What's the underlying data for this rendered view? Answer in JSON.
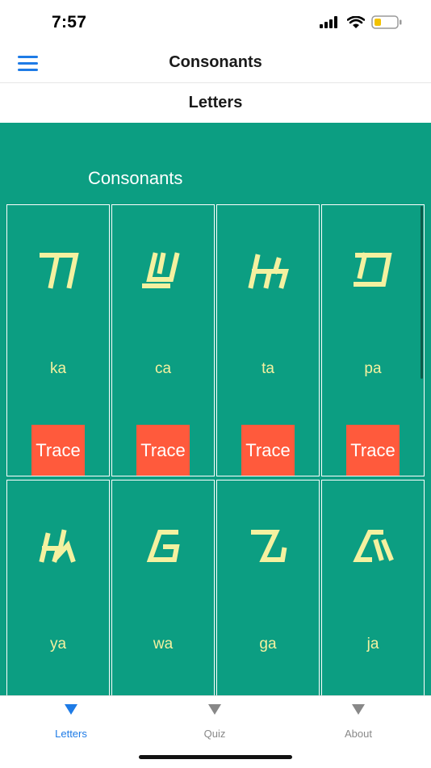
{
  "status_bar": {
    "time": "7:57",
    "icons": [
      "signal-icon",
      "wifi-icon",
      "battery-low-icon"
    ]
  },
  "navbar": {
    "title": "Consonants",
    "menu_icon": "hamburger-menu-icon",
    "accent_color": "#1e7be6"
  },
  "subheader": {
    "title": "Letters"
  },
  "content": {
    "section_title": "Consonants",
    "background_color": "#0c9e82",
    "letters": [
      {
        "glyph_icon": "ka-glyph-icon",
        "romanized": "ka",
        "trace_label": "Trace"
      },
      {
        "glyph_icon": "ca-glyph-icon",
        "romanized": "ca",
        "trace_label": "Trace"
      },
      {
        "glyph_icon": "ta-glyph-icon",
        "romanized": "ta",
        "trace_label": "Trace"
      },
      {
        "glyph_icon": "pa-glyph-icon",
        "romanized": "pa",
        "trace_label": "Trace"
      },
      {
        "glyph_icon": "ya-glyph-icon",
        "romanized": "ya"
      },
      {
        "glyph_icon": "wa-glyph-icon",
        "romanized": "wa"
      },
      {
        "glyph_icon": "ga-glyph-icon",
        "romanized": "ga"
      },
      {
        "glyph_icon": "ja-glyph-icon",
        "romanized": "ja"
      }
    ],
    "glyph_color": "#f4f1a0",
    "trace_color": "#ff5a3c"
  },
  "tab_bar": {
    "tabs": [
      {
        "label": "Letters",
        "icon": "triangle-down-icon",
        "active": true
      },
      {
        "label": "Quiz",
        "icon": "triangle-down-icon",
        "active": false
      },
      {
        "label": "About",
        "icon": "triangle-down-icon",
        "active": false
      }
    ]
  }
}
